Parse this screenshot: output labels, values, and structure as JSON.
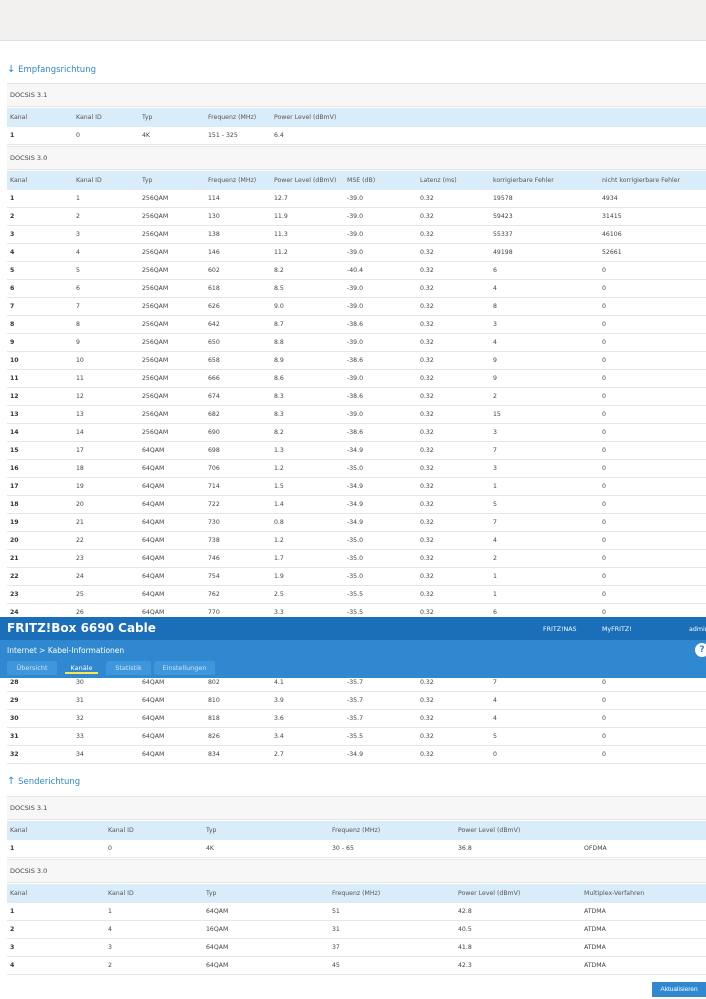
{
  "header": {
    "brand": "FRITZ!Box 6690 Cable",
    "links": [
      "FRITZ!NAS",
      "MyFRITZ!",
      "admin"
    ],
    "breadcrumb": "Internet > Kabel-Informationen",
    "help": "?",
    "tabs": [
      {
        "label": "Übersicht",
        "active": false
      },
      {
        "label": "Kanäle",
        "active": true
      },
      {
        "label": "Statistik",
        "active": false
      },
      {
        "label": "Einstellungen",
        "active": false
      }
    ]
  },
  "downstream": {
    "title": "Empfangsrichtung",
    "arrow": "↓",
    "docsis31": {
      "label": "DOCSIS 3.1",
      "columns": [
        "Kanal",
        "Kanal ID",
        "Typ",
        "Frequenz (MHz)",
        "Power Level (dBmV)"
      ],
      "rows": [
        [
          "1",
          "0",
          "4K",
          "151 - 325",
          "6.4"
        ]
      ]
    },
    "docsis30": {
      "label": "DOCSIS 3.0",
      "columns": [
        "Kanal",
        "Kanal ID",
        "Typ",
        "Frequenz (MHz)",
        "Power Level (dBmV)",
        "MSE (dB)",
        "Latenz (ms)",
        "korrigierbare Fehler",
        "nicht korrigierbare Fehler"
      ],
      "rows": [
        [
          "1",
          "1",
          "256QAM",
          "114",
          "12.7",
          "-39.0",
          "0.32",
          "19578",
          "4934"
        ],
        [
          "2",
          "2",
          "256QAM",
          "130",
          "11.9",
          "-39.0",
          "0.32",
          "59423",
          "31415"
        ],
        [
          "3",
          "3",
          "256QAM",
          "138",
          "11.3",
          "-39.0",
          "0.32",
          "55337",
          "46106"
        ],
        [
          "4",
          "4",
          "256QAM",
          "146",
          "11.2",
          "-39.0",
          "0.32",
          "49198",
          "52661"
        ],
        [
          "5",
          "5",
          "256QAM",
          "602",
          "8.2",
          "-40.4",
          "0.32",
          "6",
          "0"
        ],
        [
          "6",
          "6",
          "256QAM",
          "618",
          "8.5",
          "-39.0",
          "0.32",
          "4",
          "0"
        ],
        [
          "7",
          "7",
          "256QAM",
          "626",
          "9.0",
          "-39.0",
          "0.32",
          "8",
          "0"
        ],
        [
          "8",
          "8",
          "256QAM",
          "642",
          "8.7",
          "-38.6",
          "0.32",
          "3",
          "0"
        ],
        [
          "9",
          "9",
          "256QAM",
          "650",
          "8.8",
          "-39.0",
          "0.32",
          "4",
          "0"
        ],
        [
          "10",
          "10",
          "256QAM",
          "658",
          "8.9",
          "-38.6",
          "0.32",
          "9",
          "0"
        ],
        [
          "11",
          "11",
          "256QAM",
          "666",
          "8.6",
          "-39.0",
          "0.32",
          "9",
          "0"
        ],
        [
          "12",
          "12",
          "256QAM",
          "674",
          "8.3",
          "-38.6",
          "0.32",
          "2",
          "0"
        ],
        [
          "13",
          "13",
          "256QAM",
          "682",
          "8.3",
          "-39.0",
          "0.32",
          "15",
          "0"
        ],
        [
          "14",
          "14",
          "256QAM",
          "690",
          "8.2",
          "-38.6",
          "0.32",
          "3",
          "0"
        ],
        [
          "15",
          "17",
          "64QAM",
          "698",
          "1.3",
          "-34.9",
          "0.32",
          "7",
          "0"
        ],
        [
          "16",
          "18",
          "64QAM",
          "706",
          "1.2",
          "-35.0",
          "0.32",
          "3",
          "0"
        ],
        [
          "17",
          "19",
          "64QAM",
          "714",
          "1.5",
          "-34.9",
          "0.32",
          "1",
          "0"
        ],
        [
          "18",
          "20",
          "64QAM",
          "722",
          "1.4",
          "-34.9",
          "0.32",
          "5",
          "0"
        ],
        [
          "19",
          "21",
          "64QAM",
          "730",
          "0.8",
          "-34.9",
          "0.32",
          "7",
          "0"
        ],
        [
          "20",
          "22",
          "64QAM",
          "738",
          "1.2",
          "-35.0",
          "0.32",
          "4",
          "0"
        ],
        [
          "21",
          "23",
          "64QAM",
          "746",
          "1.7",
          "-35.0",
          "0.32",
          "2",
          "0"
        ],
        [
          "22",
          "24",
          "64QAM",
          "754",
          "1.9",
          "-35.0",
          "0.32",
          "1",
          "0"
        ],
        [
          "23",
          "25",
          "64QAM",
          "762",
          "2.5",
          "-35.5",
          "0.32",
          "1",
          "0"
        ],
        [
          "24",
          "26",
          "64QAM",
          "770",
          "3.3",
          "-35.5",
          "0.32",
          "6",
          "0"
        ]
      ],
      "rows_after_overlay": [
        [
          "28",
          "30",
          "64QAM",
          "802",
          "4.1",
          "-35.7",
          "0.32",
          "7",
          "0"
        ],
        [
          "29",
          "31",
          "64QAM",
          "810",
          "3.9",
          "-35.7",
          "0.32",
          "4",
          "0"
        ],
        [
          "30",
          "32",
          "64QAM",
          "818",
          "3.6",
          "-35.7",
          "0.32",
          "4",
          "0"
        ],
        [
          "31",
          "33",
          "64QAM",
          "826",
          "3.4",
          "-35.5",
          "0.32",
          "5",
          "0"
        ],
        [
          "32",
          "34",
          "64QAM",
          "834",
          "2.7",
          "-34.9",
          "0.32",
          "0",
          "0"
        ]
      ]
    }
  },
  "upstream": {
    "title": "Senderichtung",
    "arrow": "↑",
    "docsis31": {
      "label": "DOCSIS 3.1",
      "columns": [
        "Kanal",
        "Kanal ID",
        "Typ",
        "Frequenz (MHz)",
        "Power Level (dBmV)",
        ""
      ],
      "rows": [
        [
          "1",
          "0",
          "4K",
          "30 - 65",
          "36.8",
          "OFDMA"
        ]
      ]
    },
    "docsis30": {
      "label": "DOCSIS 3.0",
      "columns": [
        "Kanal",
        "Kanal ID",
        "Typ",
        "Frequenz (MHz)",
        "Power Level (dBmV)",
        "Multiplex-Verfahren"
      ],
      "rows": [
        [
          "1",
          "1",
          "64QAM",
          "51",
          "42.8",
          "ATDMA"
        ],
        [
          "2",
          "4",
          "16QAM",
          "31",
          "40.5",
          "ATDMA"
        ],
        [
          "3",
          "3",
          "64QAM",
          "37",
          "41.8",
          "ATDMA"
        ],
        [
          "4",
          "2",
          "64QAM",
          "45",
          "42.3",
          "ATDMA"
        ]
      ]
    }
  },
  "footer": {
    "refresh_label": "Aktualisieren"
  }
}
